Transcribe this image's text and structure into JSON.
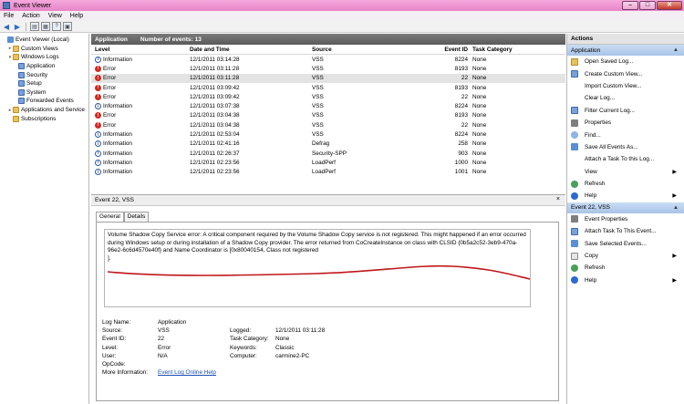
{
  "window": {
    "title": "Event Viewer"
  },
  "menu": [
    "File",
    "Action",
    "View",
    "Help"
  ],
  "tree": [
    {
      "label": "Event Viewer (Local)",
      "arrow": "",
      "icon": "viewer-icon",
      "indent": 0
    },
    {
      "label": "Custom Views",
      "arrow": "▸",
      "icon": "folder-icon",
      "indent": 1
    },
    {
      "label": "Windows Logs",
      "arrow": "▾",
      "icon": "folder-icon",
      "indent": 1
    },
    {
      "label": "Application",
      "arrow": "",
      "icon": "log-icon",
      "indent": 2
    },
    {
      "label": "Security",
      "arrow": "",
      "icon": "log-icon",
      "indent": 2
    },
    {
      "label": "Setup",
      "arrow": "",
      "icon": "log-icon",
      "indent": 2
    },
    {
      "label": "System",
      "arrow": "",
      "icon": "log-icon",
      "indent": 2
    },
    {
      "label": "Forwarded Events",
      "arrow": "",
      "icon": "log-icon",
      "indent": 2
    },
    {
      "label": "Applications and Service",
      "arrow": "▸",
      "icon": "folder-icon",
      "indent": 1
    },
    {
      "label": "Subscriptions",
      "arrow": "",
      "icon": "folder-icon",
      "indent": 1
    }
  ],
  "list": {
    "title": "Application",
    "count": "Number of events: 13",
    "columns": {
      "level": "Level",
      "date": "Date and Time",
      "source": "Source",
      "id": "Event ID",
      "task": "Task Category"
    },
    "rows": [
      {
        "level": "Information",
        "type": "info",
        "date": "12/1/2011 03:14:28",
        "source": "VSS",
        "id": "8224",
        "task": "None"
      },
      {
        "level": "Error",
        "type": "err",
        "date": "12/1/2011 03:11:28",
        "source": "VSS",
        "id": "8193",
        "task": "None"
      },
      {
        "level": "Error",
        "type": "err",
        "date": "12/1/2011 03:11:28",
        "source": "VSS",
        "id": "22",
        "task": "None"
      },
      {
        "level": "Error",
        "type": "err",
        "date": "12/1/2011 03:09:42",
        "source": "VSS",
        "id": "8193",
        "task": "None"
      },
      {
        "level": "Error",
        "type": "err",
        "date": "12/1/2011 03:09:42",
        "source": "VSS",
        "id": "22",
        "task": "None"
      },
      {
        "level": "Information",
        "type": "info",
        "date": "12/1/2011 03:07:38",
        "source": "VSS",
        "id": "8224",
        "task": "None"
      },
      {
        "level": "Error",
        "type": "err",
        "date": "12/1/2011 03:04:38",
        "source": "VSS",
        "id": "8193",
        "task": "None"
      },
      {
        "level": "Error",
        "type": "err",
        "date": "12/1/2011 03:04:38",
        "source": "VSS",
        "id": "22",
        "task": "None"
      },
      {
        "level": "Information",
        "type": "info",
        "date": "12/1/2011 02:53:04",
        "source": "VSS",
        "id": "8224",
        "task": "None"
      },
      {
        "level": "Information",
        "type": "info",
        "date": "12/1/2011 02:41:16",
        "source": "Defrag",
        "id": "258",
        "task": "None"
      },
      {
        "level": "Information",
        "type": "info",
        "date": "12/1/2011 02:26:37",
        "source": "Security-SPP",
        "id": "903",
        "task": "None"
      },
      {
        "level": "Information",
        "type": "info",
        "date": "12/1/2011 02:23:56",
        "source": "LoadPerf",
        "id": "1000",
        "task": "None"
      },
      {
        "level": "Information",
        "type": "info",
        "date": "12/1/2011 02:23:56",
        "source": "LoadPerf",
        "id": "1001",
        "task": "None"
      }
    ]
  },
  "detail": {
    "title": "Event 22, VSS",
    "close": "×",
    "tabs": [
      "General",
      "Details"
    ],
    "description": "Volume Shadow Copy Service error: A critical component required by the Volume Shadow Copy service is not registered. This might happened if an error occurred during Windows setup or during installation of a Shadow Copy provider. The error returned from CoCreateInstance on class with CLSID {0b5a2c52-3eb9-470a-96e2-6c6d4570e40f} and Name Coordinator is [0x80040154, Class not registered",
    "description_tail": "].",
    "props": {
      "log_name_label": "Log Name:",
      "log_name": "Application",
      "source_label": "Source:",
      "source": "VSS",
      "logged_label": "Logged:",
      "logged": "12/1/2011 03:11:28",
      "event_id_label": "Event ID:",
      "event_id": "22",
      "task_label": "Task Category:",
      "task": "None",
      "level_label": "Level:",
      "level": "Error",
      "keywords_label": "Keywords:",
      "keywords": "Classic",
      "user_label": "User:",
      "user": "N/A",
      "computer_label": "Computer:",
      "computer": "carmine2-PC",
      "opcode_label": "OpCode:",
      "opcode": "",
      "more_info_label": "More Information:",
      "more_info_link": "Event Log Online Help"
    }
  },
  "actions": {
    "title": "Actions",
    "section1": "Application",
    "items1": [
      {
        "label": "Open Saved Log...",
        "icon": "open-icon",
        "sub": false
      },
      {
        "label": "Create Custom View...",
        "icon": "filter-icon",
        "sub": false
      },
      {
        "label": "Import Custom View...",
        "icon": "blank",
        "sub": false
      },
      {
        "label": "Clear Log...",
        "icon": "blank",
        "sub": false
      },
      {
        "label": "Filter Current Log...",
        "icon": "filter-icon",
        "sub": false
      },
      {
        "label": "Properties",
        "icon": "properties-icon",
        "sub": false
      },
      {
        "label": "Find...",
        "icon": "find-icon",
        "sub": false
      },
      {
        "label": "Save All Events As...",
        "icon": "save-icon",
        "sub": false
      },
      {
        "label": "Attach a Task To this Log...",
        "icon": "blank",
        "sub": false
      },
      {
        "label": "View",
        "icon": "blank",
        "sub": true
      },
      {
        "label": "Refresh",
        "icon": "refresh-icon",
        "sub": false
      },
      {
        "label": "Help",
        "icon": "help-icon",
        "sub": true
      }
    ],
    "section2": "Event 22, VSS",
    "items2": [
      {
        "label": "Event Properties",
        "icon": "properties-icon",
        "sub": false
      },
      {
        "label": "Attach Task To This Event...",
        "icon": "filter-icon",
        "sub": false
      },
      {
        "label": "Save Selected Events...",
        "icon": "save-icon",
        "sub": false
      },
      {
        "label": "Copy",
        "icon": "copy-icon",
        "sub": true
      },
      {
        "label": "Refresh",
        "icon": "refresh-icon",
        "sub": false
      },
      {
        "label": "Help",
        "icon": "help-icon",
        "sub": true
      }
    ]
  }
}
